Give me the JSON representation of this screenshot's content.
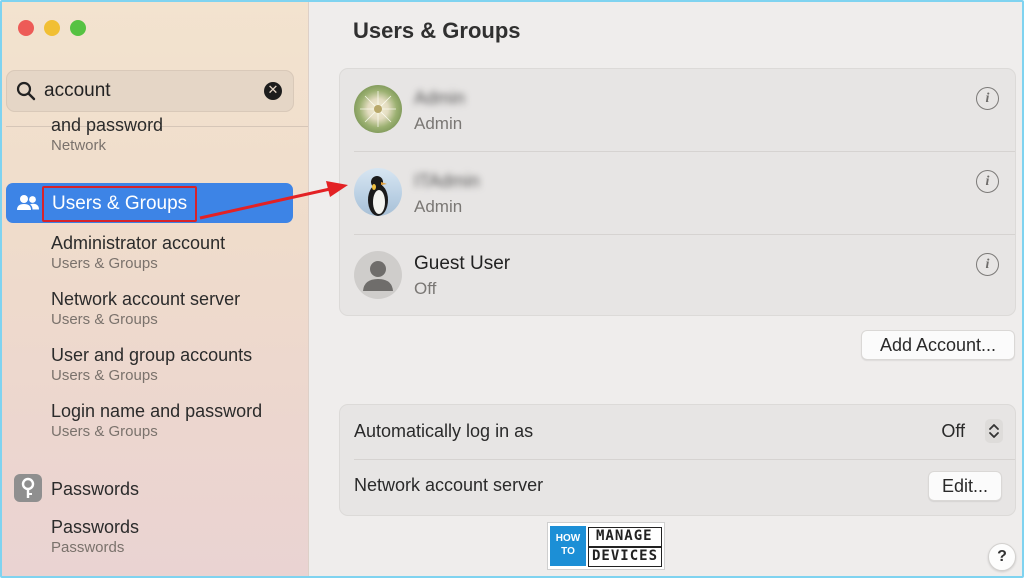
{
  "search": {
    "query": "account"
  },
  "sidebar": {
    "results": [
      {
        "title": "and password",
        "subtitle": "Network"
      },
      {
        "title": "Users & Groups",
        "selected": true
      },
      {
        "title": "Administrator account",
        "subtitle": "Users & Groups"
      },
      {
        "title": "Network account server",
        "subtitle": "Users & Groups"
      },
      {
        "title": "User and group accounts",
        "subtitle": "Users & Groups"
      },
      {
        "title": "Login name and password",
        "subtitle": "Users & Groups"
      },
      {
        "title": "Passwords"
      },
      {
        "title": "Passwords",
        "subtitle": "Passwords"
      }
    ]
  },
  "main": {
    "title": "Users & Groups",
    "users": [
      {
        "name": "Admin",
        "role": "Admin",
        "avatar": "dandelion-avatar",
        "blurred": true
      },
      {
        "name": "ITAdmin",
        "role": "Admin",
        "avatar": "penguin-avatar",
        "blurred": true
      },
      {
        "name": "Guest User",
        "role": "Off",
        "avatar": "person-avatar"
      }
    ],
    "add_account_label": "Add Account...",
    "settings": {
      "auto_login_label": "Automatically log in as",
      "auto_login_value": "Off",
      "network_server_label": "Network account server",
      "edit_label": "Edit..."
    },
    "help_label": "?"
  },
  "watermark": {
    "how": "HOW",
    "to": "TO",
    "manage": "MANAGE",
    "devices": "DEVICES"
  },
  "colors": {
    "accent": "#3d84e6",
    "highlight_box": "#d6232a",
    "arrow": "#e32124"
  }
}
